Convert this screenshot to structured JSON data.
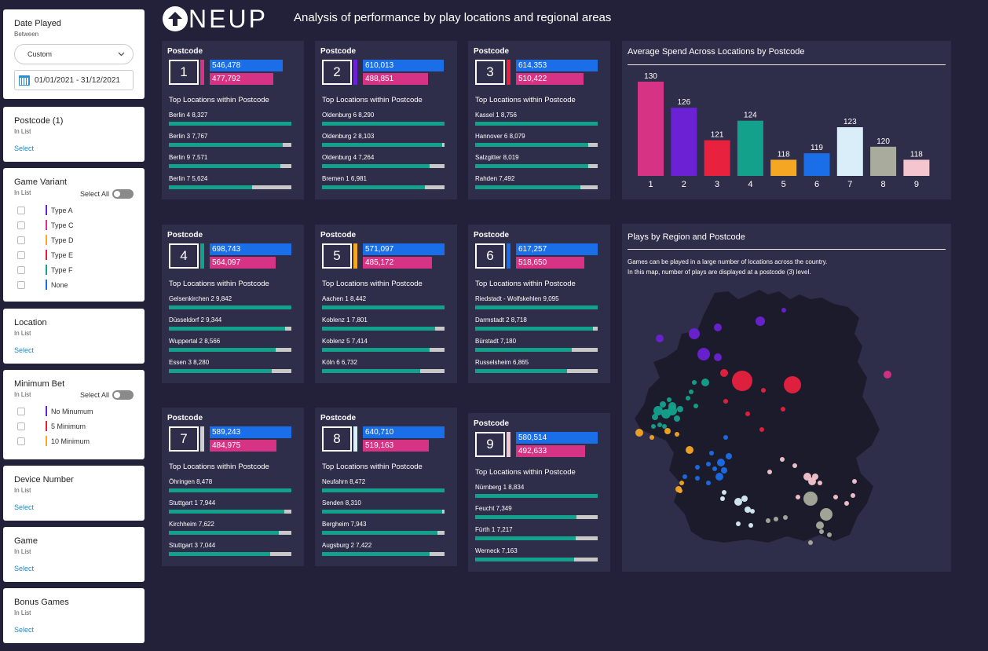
{
  "header": {
    "logo_text": "NEUP",
    "title": "Analysis of performance by play locations and regional areas"
  },
  "sidebar": {
    "date_played": {
      "title": "Date Played",
      "sub": "Between",
      "dropdown": "Custom",
      "range": "01/01/2021 - 31/12/2021"
    },
    "postcode": {
      "title": "Postcode (1)",
      "sub": "In List",
      "select": "Select"
    },
    "game_variant": {
      "title": "Game Variant",
      "sub": "In List",
      "select_all": "Select All",
      "options": [
        {
          "label": "Type A",
          "color": "#6a22d4"
        },
        {
          "label": "Type C",
          "color": "#d63384"
        },
        {
          "label": "Type D",
          "color": "#f5a623"
        },
        {
          "label": "Type E",
          "color": "#e8213f"
        },
        {
          "label": "Type F",
          "color": "#14a18b"
        },
        {
          "label": "None",
          "color": "#1a6ee8"
        }
      ]
    },
    "location": {
      "title": "Location",
      "sub": "In List",
      "select": "Select"
    },
    "minimum_bet": {
      "title": "Minimum Bet",
      "sub": "In List",
      "select_all": "Select All",
      "options": [
        {
          "label": "No Minumum",
          "color": "#6a22d4"
        },
        {
          "label": "5 Minimum",
          "color": "#e8213f"
        },
        {
          "label": "10 Minimum",
          "color": "#f5a623"
        }
      ]
    },
    "device_number": {
      "title": "Device Number",
      "sub": "In List",
      "select": "Select"
    },
    "game": {
      "title": "Game",
      "sub": "In List",
      "select": "Select"
    },
    "bonus_games": {
      "title": "Bonus Games",
      "sub": "In List",
      "select": "Select"
    }
  },
  "postcode_cards": [
    {
      "label": "Postcode",
      "num": "1",
      "accent": "#d63384",
      "blue": "546,478",
      "pink": "477,792",
      "blue_pct": 0.89,
      "pink_pct": 0.78,
      "sub": "Top Locations within Postcode",
      "locs": [
        {
          "label": "Berlin 4  8,327",
          "pct": 1.0
        },
        {
          "label": "Berlin 3  7,767",
          "pct": 0.93
        },
        {
          "label": "Berlin 9  7,571",
          "pct": 0.91
        },
        {
          "label": "Berlin 7  5,624",
          "pct": 0.68
        }
      ]
    },
    {
      "label": "Postcode",
      "num": "2",
      "accent": "#6a22d4",
      "blue": "610,013",
      "pink": "488,851",
      "blue_pct": 0.99,
      "pink_pct": 0.8,
      "sub": "Top Locations within Postcode",
      "locs": [
        {
          "label": "Oldenburg 6  8,290",
          "pct": 1.0
        },
        {
          "label": "Oldenburg 2  8,103",
          "pct": 0.98
        },
        {
          "label": "Oldenburg 4  7,264",
          "pct": 0.88
        },
        {
          "label": "Bremen 1  6,981",
          "pct": 0.84
        }
      ]
    },
    {
      "label": "Postcode",
      "num": "3",
      "accent": "#e8213f",
      "blue": "614,353",
      "pink": "510,422",
      "blue_pct": 1.0,
      "pink_pct": 0.83,
      "sub": "Top Locations within Postcode",
      "locs": [
        {
          "label": "Kassel 1  8,756",
          "pct": 1.0
        },
        {
          "label": "Hannover 6  8,079",
          "pct": 0.92
        },
        {
          "label": "Salzgitter  8,019",
          "pct": 0.92
        },
        {
          "label": "Rahden  7,492",
          "pct": 0.86
        }
      ]
    },
    {
      "label": "Postcode",
      "num": "4",
      "accent": "#14a18b",
      "blue": "698,743",
      "pink": "564,097",
      "blue_pct": 1.0,
      "pink_pct": 0.81,
      "sub": "Top Locations within Postcode",
      "locs": [
        {
          "label": "Gelsenkirchen 2  9,842",
          "pct": 1.0
        },
        {
          "label": "Düsseldorf 2  9,344",
          "pct": 0.95
        },
        {
          "label": "Wuppertal 2  8,566",
          "pct": 0.87
        },
        {
          "label": "Essen 3  8,280",
          "pct": 0.84
        }
      ]
    },
    {
      "label": "Postcode",
      "num": "5",
      "accent": "#f5a623",
      "blue": "571,097",
      "pink": "485,172",
      "blue_pct": 1.0,
      "pink_pct": 0.85,
      "sub": "Top Locations within Postcode",
      "locs": [
        {
          "label": "Aachen 1  8,442",
          "pct": 1.0
        },
        {
          "label": "Koblenz 1  7,801",
          "pct": 0.92
        },
        {
          "label": "Koblenz 5  7,414",
          "pct": 0.88
        },
        {
          "label": "Köln 6  6,732",
          "pct": 0.8
        }
      ]
    },
    {
      "label": "Postcode",
      "num": "6",
      "accent": "#1a6ee8",
      "blue": "617,257",
      "pink": "518,650",
      "blue_pct": 1.0,
      "pink_pct": 0.84,
      "sub": "Top Locations within Postcode",
      "locs": [
        {
          "label": "Riedstadt - Wolfskehlen  9,095",
          "pct": 1.0
        },
        {
          "label": "Darmstadt 2  8,718",
          "pct": 0.96
        },
        {
          "label": "Bürstadt  7,180",
          "pct": 0.79
        },
        {
          "label": "Russelsheim  6,865",
          "pct": 0.75
        }
      ]
    },
    {
      "label": "Postcode",
      "num": "7",
      "accent": "#cfcfcf",
      "blue": "589,243",
      "pink": "484,975",
      "blue_pct": 1.0,
      "pink_pct": 0.82,
      "sub": "Top Locations within Postcode",
      "locs": [
        {
          "label": "Öhringen  8,478",
          "pct": 1.0
        },
        {
          "label": "Stuttgart 1  7,944",
          "pct": 0.94
        },
        {
          "label": "Kirchheim  7,622",
          "pct": 0.9
        },
        {
          "label": "Stuttgart 3  7,044",
          "pct": 0.83
        }
      ]
    },
    {
      "label": "Postcode",
      "num": "8",
      "accent": "#d9eef8",
      "blue": "640,710",
      "pink": "519,163",
      "blue_pct": 1.0,
      "pink_pct": 0.81,
      "sub": "Top Locations within Postcode",
      "locs": [
        {
          "label": "Neufahrn  8,472",
          "pct": 1.0
        },
        {
          "label": "Senden  8,310",
          "pct": 0.98
        },
        {
          "label": "Bergheim  7,943",
          "pct": 0.94
        },
        {
          "label": "Augsburg 2  7,422",
          "pct": 0.88
        }
      ]
    },
    {
      "label": "Postcode",
      "num": "9",
      "accent": "#f5c5cf",
      "blue": "580,514",
      "pink": "492,633",
      "blue_pct": 1.0,
      "pink_pct": 0.85,
      "sub": "Top Locations within Postcode",
      "locs": [
        {
          "label": "Nürnberg 1  8,834",
          "pct": 1.0
        },
        {
          "label": "Feucht  7,349",
          "pct": 0.83
        },
        {
          "label": "Fürth 1  7,217",
          "pct": 0.82
        },
        {
          "label": "Werneck  7,163",
          "pct": 0.81
        }
      ]
    }
  ],
  "chart_data": {
    "type": "bar",
    "title": "Average Spend Across Locations by Postcode",
    "categories": [
      "1",
      "2",
      "3",
      "4",
      "5",
      "6",
      "7",
      "8",
      "9"
    ],
    "values": [
      130,
      126,
      121,
      124,
      118,
      119,
      123,
      120,
      118
    ],
    "colors": [
      "#d63384",
      "#6a22d4",
      "#e8213f",
      "#14a18b",
      "#f5a623",
      "#1a6ee8",
      "#d9eef8",
      "#a9ab9c",
      "#f5c5cf"
    ],
    "xlabel": "",
    "ylabel": "",
    "grid": false,
    "legend": "none"
  },
  "map": {
    "title": "Plays by Region and Postcode",
    "note_line1": "Games can be played in a large number of locations across the country.",
    "note_line2": "In this map, number of plays are displayed at a postcode (3) level."
  }
}
